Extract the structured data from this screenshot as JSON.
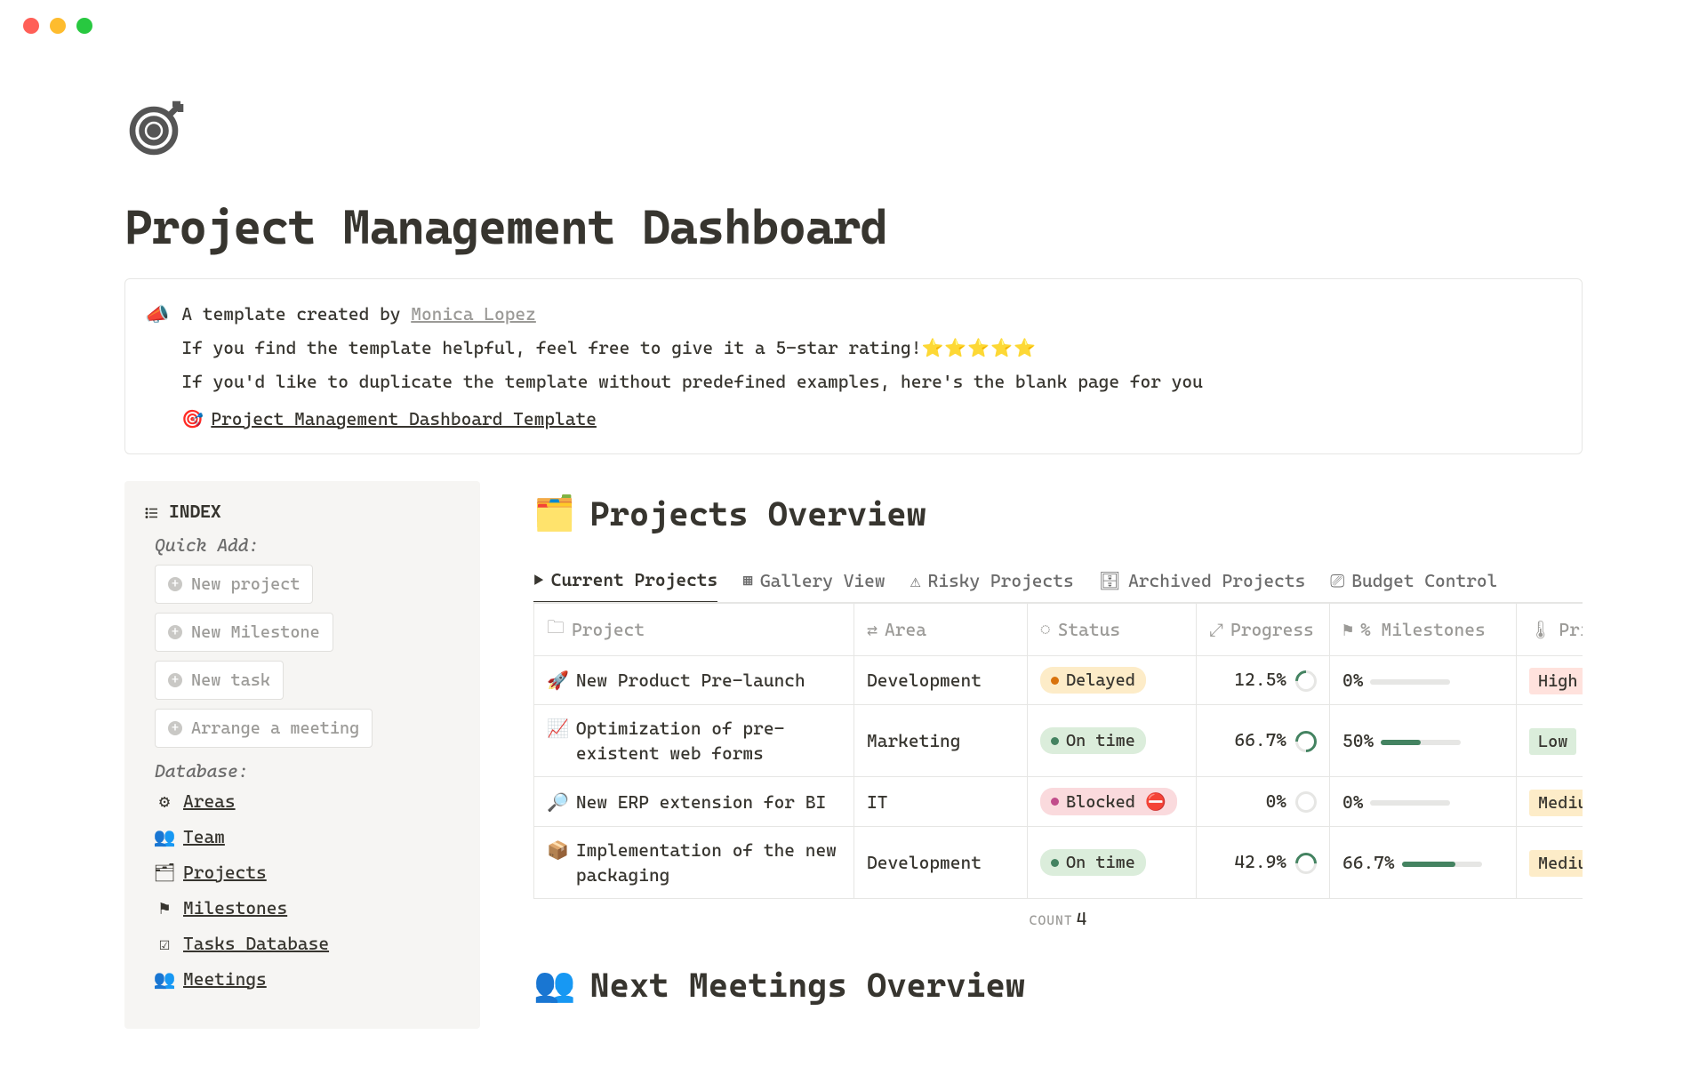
{
  "page": {
    "title": "Project Management Dashboard"
  },
  "callout": {
    "prefix": "A template created by ",
    "author": "Monica Lopez",
    "line2a": "If you find the template helpful, feel free to give it a 5-star rating!",
    "stars": "⭐⭐⭐⭐⭐",
    "line3": "If you'd like to duplicate the template without predefined examples, here's the blank page for you",
    "template_link": "Project Management Dashboard Template"
  },
  "sidebar": {
    "index_title": "INDEX",
    "quick_add_label": "Quick Add:",
    "quick": [
      {
        "label": "New project"
      },
      {
        "label": "New Milestone"
      },
      {
        "label": "New task"
      },
      {
        "label": "Arrange a meeting"
      }
    ],
    "database_label": "Database:",
    "db": [
      {
        "label": "Areas"
      },
      {
        "label": "Team"
      },
      {
        "label": "Projects"
      },
      {
        "label": "Milestones"
      },
      {
        "label": "Tasks Database"
      },
      {
        "label": "Meetings"
      }
    ]
  },
  "overview": {
    "heading": "Projects Overview",
    "tabs": [
      {
        "label": "Current Projects"
      },
      {
        "label": "Gallery View"
      },
      {
        "label": "Risky Projects"
      },
      {
        "label": "Archived Projects"
      },
      {
        "label": "Budget Control"
      }
    ],
    "columns": {
      "project": "Project",
      "area": "Area",
      "status": "Status",
      "progress": "Progress",
      "milestones": "% Milestones",
      "priority": "Prior"
    },
    "rows": [
      {
        "emoji": "🚀",
        "name": "New Product Pre-launch",
        "area": "Development",
        "status": "Delayed",
        "status_class": "delayed",
        "dot": "orange",
        "progress": "12.5%",
        "milestones": "0%",
        "mile_fill": 0,
        "priority": "High",
        "pri_class": "high"
      },
      {
        "emoji": "📈",
        "name": "Optimization of pre-existent web forms",
        "area": "Marketing",
        "status": "On time",
        "status_class": "ontime",
        "dot": "green",
        "progress": "66.7%",
        "milestones": "50%",
        "mile_fill": 50,
        "priority": "Low",
        "pri_class": "low"
      },
      {
        "emoji": "🔎",
        "name": "New ERP extension for BI",
        "area": "IT",
        "status": "Blocked",
        "status_class": "blocked",
        "dot": "pink",
        "status_extra": "⛔",
        "progress": "0%",
        "milestones": "0%",
        "mile_fill": 0,
        "priority": "Medium",
        "pri_class": "medium"
      },
      {
        "emoji": "📦",
        "name": "Implementation of the new packaging",
        "area": "Development",
        "status": "On time",
        "status_class": "ontime",
        "dot": "green",
        "progress": "42.9%",
        "milestones": "66.7%",
        "mile_fill": 66.7,
        "priority": "Medium",
        "pri_class": "medium"
      }
    ],
    "count_label": "COUNT",
    "count": "4"
  },
  "meetings": {
    "heading": "Next Meetings Overview"
  }
}
